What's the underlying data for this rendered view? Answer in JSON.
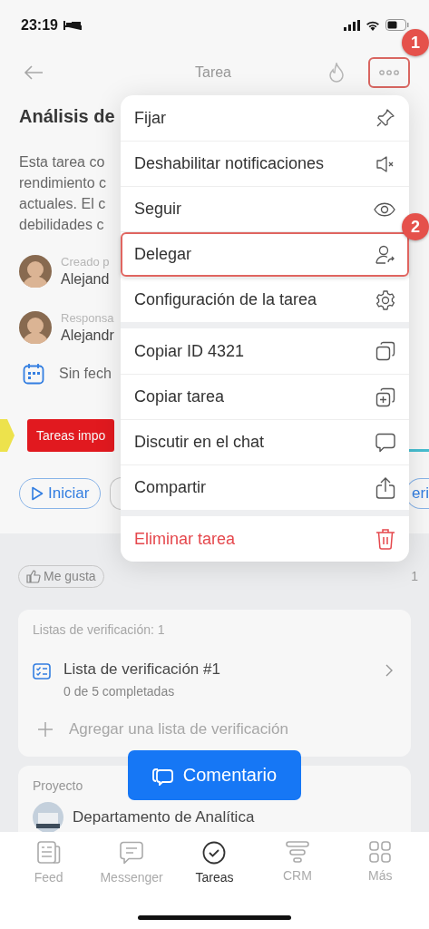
{
  "status_bar": {
    "time": "23:19"
  },
  "header": {
    "title": "Tarea",
    "more_callout": "1"
  },
  "task": {
    "title": "Análisis de",
    "description_lines": [
      "Esta tarea co",
      "rendimiento c",
      "actuales. El c",
      "debilidades c"
    ],
    "people": [
      {
        "label": "Creado p",
        "name": "Alejand"
      },
      {
        "label": "Responsa",
        "name": "Alejandr"
      }
    ],
    "deadline": "Sin fech",
    "tag": "Tareas impo"
  },
  "actions": {
    "start": "Iniciar",
    "right_fragment": "eri"
  },
  "reactions": {
    "like": "Me gusta",
    "views": "1"
  },
  "checklists": {
    "header": "Listas de verificación: 1",
    "items": [
      {
        "title": "Lista de verificación #1",
        "progress": "0 de 5 completadas"
      }
    ],
    "add": "Agregar una lista de verificación"
  },
  "project": {
    "label": "Proyecto",
    "name": "Departamento de Analítica"
  },
  "comment_button": "Comentario",
  "menu": {
    "groups": [
      [
        {
          "label": "Fijar",
          "kind": "normal"
        },
        {
          "label": "Deshabilitar notificaciones",
          "kind": "normal"
        },
        {
          "label": "Seguir",
          "kind": "normal"
        },
        {
          "label": "Delegar",
          "kind": "normal",
          "callout": "2"
        },
        {
          "label": "Configuración de la tarea",
          "kind": "normal"
        }
      ],
      [
        {
          "label": "Copiar ID 4321",
          "kind": "normal"
        },
        {
          "label": "Copiar tarea",
          "kind": "normal"
        },
        {
          "label": "Discutir en el chat",
          "kind": "normal"
        },
        {
          "label": "Compartir",
          "kind": "normal"
        }
      ],
      [
        {
          "label": "Eliminar tarea",
          "kind": "danger"
        }
      ]
    ]
  },
  "tab_bar": [
    {
      "label": "Feed",
      "selected": false
    },
    {
      "label": "Messenger",
      "selected": false
    },
    {
      "label": "Tareas",
      "selected": true
    },
    {
      "label": "CRM",
      "selected": false
    },
    {
      "label": "Más",
      "selected": false
    }
  ]
}
